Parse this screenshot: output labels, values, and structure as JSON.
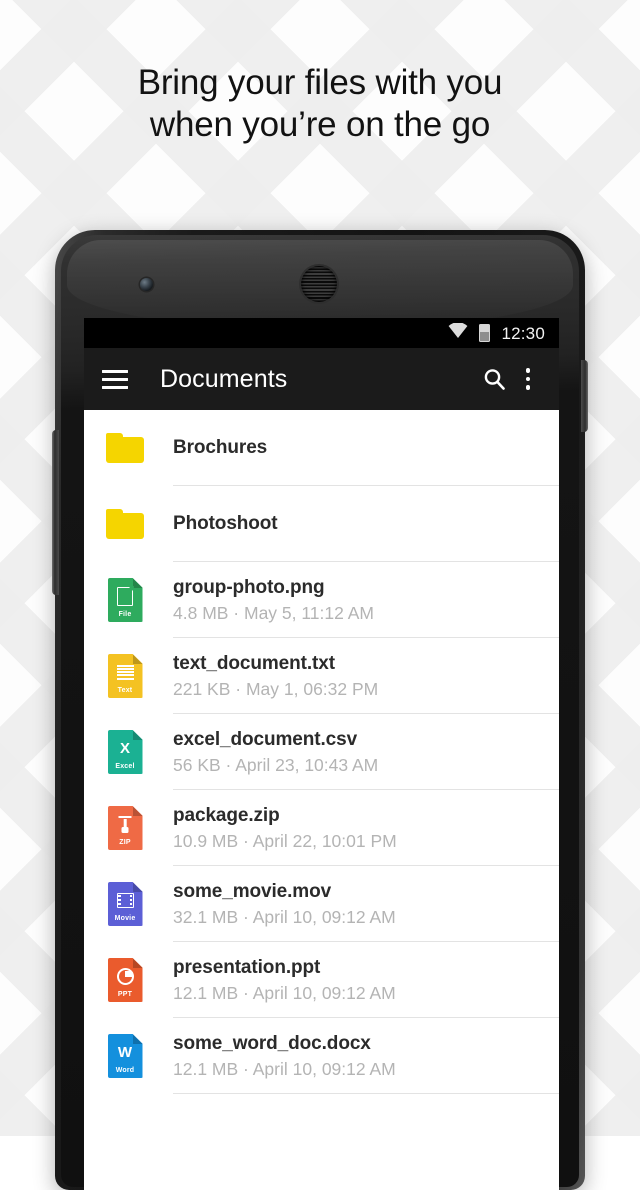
{
  "headline": {
    "line1": "Bring your files with you",
    "line2": "when you’re on the go"
  },
  "device": {
    "camera_icon": "front-camera",
    "earpiece_icon": "earpiece-speaker"
  },
  "status_bar": {
    "wifi_icon": "wifi-icon",
    "battery_icon": "battery-icon",
    "time": "12:30"
  },
  "app_bar": {
    "menu_icon": "hamburger-menu-icon",
    "title": "Documents",
    "search_icon": "search-icon",
    "overflow_icon": "overflow-menu-icon"
  },
  "colors": {
    "app_bar_bg": "#1b1b1b",
    "status_bar_bg": "#000000",
    "folder": "#f5d500",
    "file_png": "#2eab5e",
    "file_txt": "#f4c222",
    "file_csv": "#1bb193",
    "file_zip": "#ef6a45",
    "file_mov": "#5c5fd6",
    "file_ppt": "#ea5b2d",
    "file_docx": "#1490dd",
    "title_text": "#2b2b2b",
    "subtitle_text": "#b4b4b4",
    "divider": "#e3e3e3"
  },
  "files": [
    {
      "name": "Brochures",
      "meta": "",
      "kind": "folder",
      "icon": "folder-icon",
      "color": "#f5d500",
      "badge": ""
    },
    {
      "name": "Photoshoot",
      "meta": "",
      "kind": "folder",
      "icon": "folder-icon",
      "color": "#f5d500",
      "badge": ""
    },
    {
      "name": "group-photo.png",
      "meta": "4.8 MB · May 5, 11:12 AM",
      "kind": "file",
      "icon": "file-page-icon",
      "color": "#2eab5e",
      "badge": "File"
    },
    {
      "name": "text_document.txt",
      "meta": "221 KB · May 1, 06:32 PM",
      "kind": "file",
      "icon": "file-text-icon",
      "color": "#f4c222",
      "badge": "Text"
    },
    {
      "name": "excel_document.csv",
      "meta": "56 KB · April 23, 10:43 AM",
      "kind": "file",
      "icon": "file-excel-icon",
      "color": "#1bb193",
      "badge": "Excel"
    },
    {
      "name": "package.zip",
      "meta": "10.9 MB · April 22, 10:01 PM",
      "kind": "file",
      "icon": "file-zip-icon",
      "color": "#ef6a45",
      "badge": "ZIP"
    },
    {
      "name": "some_movie.mov",
      "meta": "32.1 MB · April 10, 09:12 AM",
      "kind": "file",
      "icon": "file-movie-icon",
      "color": "#5c5fd6",
      "badge": "Movie"
    },
    {
      "name": "presentation.ppt",
      "meta": "12.1 MB · April 10, 09:12 AM",
      "kind": "file",
      "icon": "file-powerpoint-icon",
      "color": "#ea5b2d",
      "badge": "PPT"
    },
    {
      "name": "some_word_doc.docx",
      "meta": "12.1 MB · April 10, 09:12 AM",
      "kind": "file",
      "icon": "file-word-icon",
      "color": "#1490dd",
      "badge": "Word"
    }
  ]
}
